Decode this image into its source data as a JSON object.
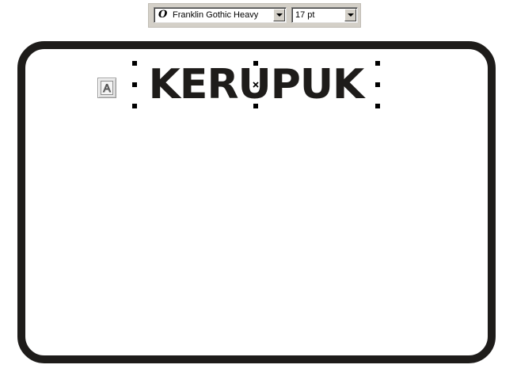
{
  "toolbar": {
    "font_type_icon": "opentype-font-icon",
    "font_type_glyph": "O",
    "font_name": "Franklin Gothic Heavy",
    "font_size": "17 pt"
  },
  "canvas": {
    "text_tool_icon": "artistic-text-tool-icon",
    "text_tool_glyph": "A",
    "artistic_text": "KERUPUK",
    "colors": {
      "frame": "#1e1c1a",
      "text": "#1e1c1a",
      "toolbar": "#d4d0c8"
    }
  }
}
